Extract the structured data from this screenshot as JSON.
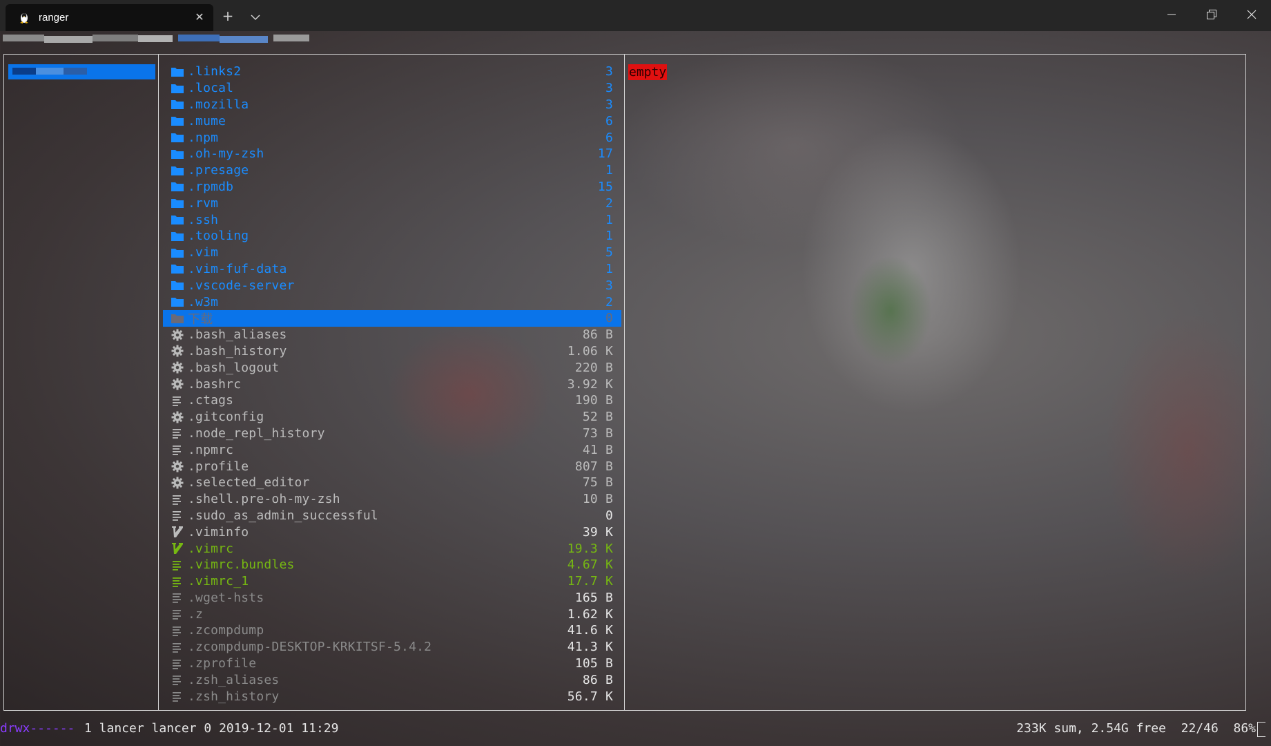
{
  "window": {
    "tab_title": "ranger",
    "tab_icon": "linux-penguin-icon",
    "new_tab": "+",
    "dropdown": "⌄",
    "close_tab": "✕"
  },
  "preview": {
    "empty_label": "empty"
  },
  "files": [
    {
      "name": ".links2",
      "size": "3",
      "kind": "dir",
      "color": "dir",
      "icon": "folder-icon"
    },
    {
      "name": ".local",
      "size": "3",
      "kind": "dir",
      "color": "dir",
      "icon": "folder-icon"
    },
    {
      "name": ".mozilla",
      "size": "3",
      "kind": "dir",
      "color": "dir",
      "icon": "folder-icon"
    },
    {
      "name": ".mume",
      "size": "6",
      "kind": "dir",
      "color": "dir",
      "icon": "folder-icon"
    },
    {
      "name": ".npm",
      "size": "6",
      "kind": "dir",
      "color": "dir",
      "icon": "folder-icon"
    },
    {
      "name": ".oh-my-zsh",
      "size": "17",
      "kind": "dir",
      "color": "dir",
      "icon": "folder-icon"
    },
    {
      "name": ".presage",
      "size": "1",
      "kind": "dir",
      "color": "dir",
      "icon": "folder-icon"
    },
    {
      "name": ".rpmdb",
      "size": "15",
      "kind": "dir",
      "color": "dir",
      "icon": "folder-icon"
    },
    {
      "name": ".rvm",
      "size": "2",
      "kind": "dir",
      "color": "dir",
      "icon": "folder-icon"
    },
    {
      "name": ".ssh",
      "size": "1",
      "kind": "dir",
      "color": "dir",
      "icon": "folder-icon"
    },
    {
      "name": ".tooling",
      "size": "1",
      "kind": "dir",
      "color": "dir",
      "icon": "folder-icon"
    },
    {
      "name": ".vim",
      "size": "5",
      "kind": "dir",
      "color": "dir",
      "icon": "folder-icon"
    },
    {
      "name": ".vim-fuf-data",
      "size": "1",
      "kind": "dir",
      "color": "dir",
      "icon": "folder-icon"
    },
    {
      "name": ".vscode-server",
      "size": "3",
      "kind": "dir",
      "color": "dir",
      "icon": "folder-icon"
    },
    {
      "name": ".w3m",
      "size": "2",
      "kind": "dir",
      "color": "dir",
      "icon": "folder-icon"
    },
    {
      "name": "下载",
      "size": "0",
      "kind": "dir",
      "color": "dir",
      "icon": "folder-icon",
      "selected": true
    },
    {
      "name": ".bash_aliases",
      "size": "86 B",
      "kind": "file",
      "color": "file",
      "icon": "gear-icon"
    },
    {
      "name": ".bash_history",
      "size": "1.06 K",
      "kind": "file",
      "color": "file",
      "icon": "gear-icon"
    },
    {
      "name": ".bash_logout",
      "size": "220 B",
      "kind": "file",
      "color": "file",
      "icon": "gear-icon"
    },
    {
      "name": ".bashrc",
      "size": "3.92 K",
      "kind": "file",
      "color": "file",
      "icon": "gear-icon"
    },
    {
      "name": ".ctags",
      "size": "190 B",
      "kind": "file",
      "color": "file",
      "icon": "text-file-icon"
    },
    {
      "name": ".gitconfig",
      "size": "52 B",
      "kind": "file",
      "color": "file",
      "icon": "gear-icon"
    },
    {
      "name": ".node_repl_history",
      "size": "73 B",
      "kind": "file",
      "color": "file",
      "icon": "text-file-icon"
    },
    {
      "name": ".npmrc",
      "size": "41 B",
      "kind": "file",
      "color": "file",
      "icon": "text-file-icon"
    },
    {
      "name": ".profile",
      "size": "807 B",
      "kind": "file",
      "color": "file",
      "icon": "gear-icon"
    },
    {
      "name": ".selected_editor",
      "size": "75 B",
      "kind": "file",
      "color": "file",
      "icon": "gear-icon"
    },
    {
      "name": ".shell.pre-oh-my-zsh",
      "size": "10 B",
      "kind": "file",
      "color": "file",
      "icon": "text-file-icon"
    },
    {
      "name": ".sudo_as_admin_successful",
      "size": "0",
      "kind": "file",
      "color": "file",
      "icon": "text-file-icon"
    },
    {
      "name": ".viminfo",
      "size": "39 K",
      "kind": "file",
      "color": "file",
      "icon": "vim-icon"
    },
    {
      "name": ".vimrc",
      "size": "19.3 K",
      "kind": "file",
      "color": "green",
      "icon": "vim-icon"
    },
    {
      "name": ".vimrc.bundles",
      "size": "4.67 K",
      "kind": "file",
      "color": "green",
      "icon": "text-file-icon"
    },
    {
      "name": ".vimrc_1",
      "size": "17.7 K",
      "kind": "file",
      "color": "green",
      "icon": "text-file-icon"
    },
    {
      "name": ".wget-hsts",
      "size": "165 B",
      "kind": "file",
      "color": "dim",
      "icon": "text-file-icon"
    },
    {
      "name": ".z",
      "size": "1.62 K",
      "kind": "file",
      "color": "dim",
      "icon": "text-file-icon"
    },
    {
      "name": ".zcompdump",
      "size": "41.6 K",
      "kind": "file",
      "color": "dim",
      "icon": "text-file-icon"
    },
    {
      "name": ".zcompdump-DESKTOP-KRKITSF-5.4.2",
      "size": "41.3 K",
      "kind": "file",
      "color": "dim",
      "icon": "text-file-icon"
    },
    {
      "name": ".zprofile",
      "size": "105 B",
      "kind": "file",
      "color": "dim",
      "icon": "text-file-icon"
    },
    {
      "name": ".zsh_aliases",
      "size": "86 B",
      "kind": "file",
      "color": "dim",
      "icon": "text-file-icon"
    },
    {
      "name": ".zsh_history",
      "size": "56.7 K",
      "kind": "file",
      "color": "dim",
      "icon": "text-file-icon"
    }
  ],
  "status": {
    "permissions": "drwx------",
    "info": "1 lancer lancer 0 2019-12-01 11:29",
    "right": "233K sum, 2.54G free  22/46  86%"
  },
  "colors": {
    "accent": "#0a74ea",
    "directory": "#1a8cff",
    "executable": "#76b812",
    "empty_badge": "#e01010",
    "permissions": "#8a3cff"
  }
}
